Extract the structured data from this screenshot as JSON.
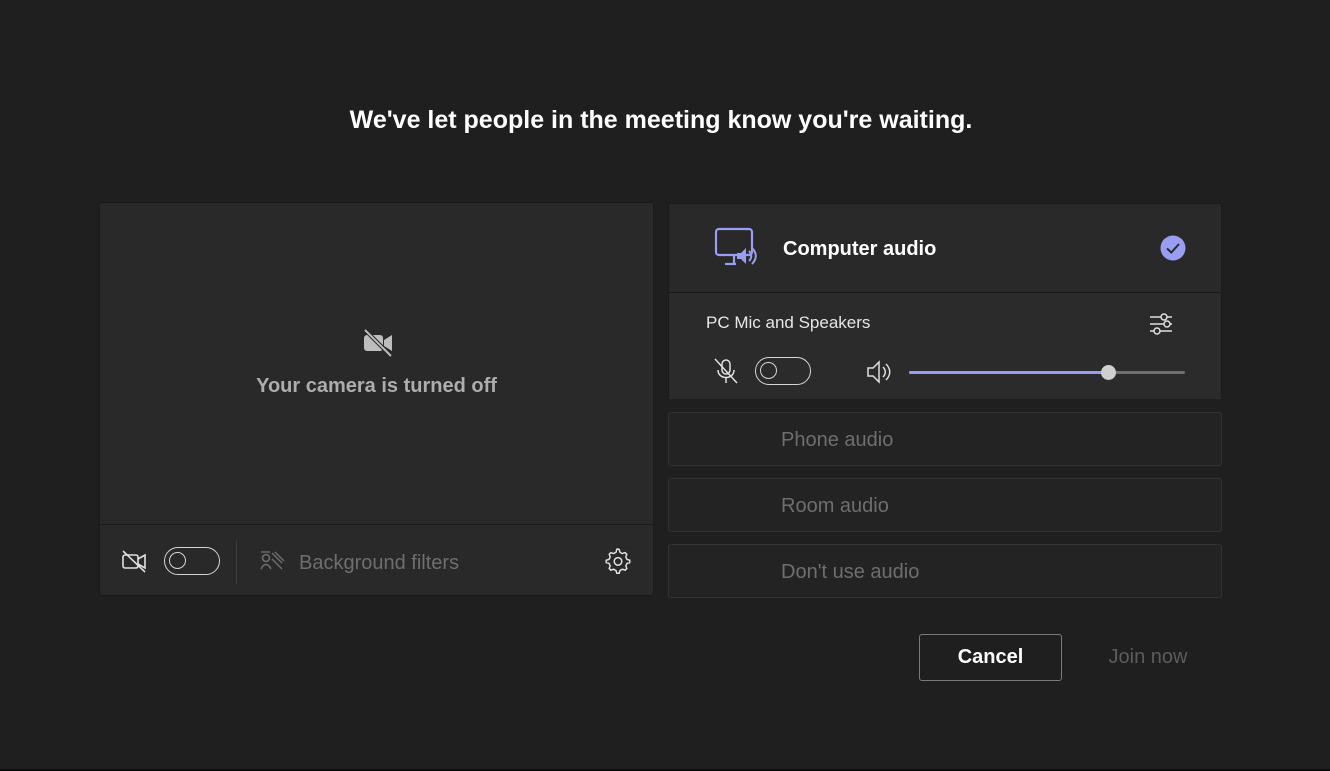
{
  "heading": "We've let people in the meeting know you're waiting.",
  "camera": {
    "status_text": "Your camera is turned off",
    "camera_toggle_on": false,
    "background_filters_label": "Background filters"
  },
  "audio": {
    "computer_audio": {
      "label": "Computer audio",
      "selected": true,
      "device_label": "PC Mic and Speakers",
      "mic_toggle_on": false,
      "volume_percent": 72
    },
    "options": [
      {
        "label": "Phone audio"
      },
      {
        "label": "Room audio"
      },
      {
        "label": "Don't use audio"
      }
    ]
  },
  "buttons": {
    "cancel_label": "Cancel",
    "join_label": "Join now"
  },
  "colors": {
    "background": "#1f1f1f",
    "panel": "#292929",
    "accent": "#9a9ef2",
    "disabled_text": "#6e6e6e"
  }
}
